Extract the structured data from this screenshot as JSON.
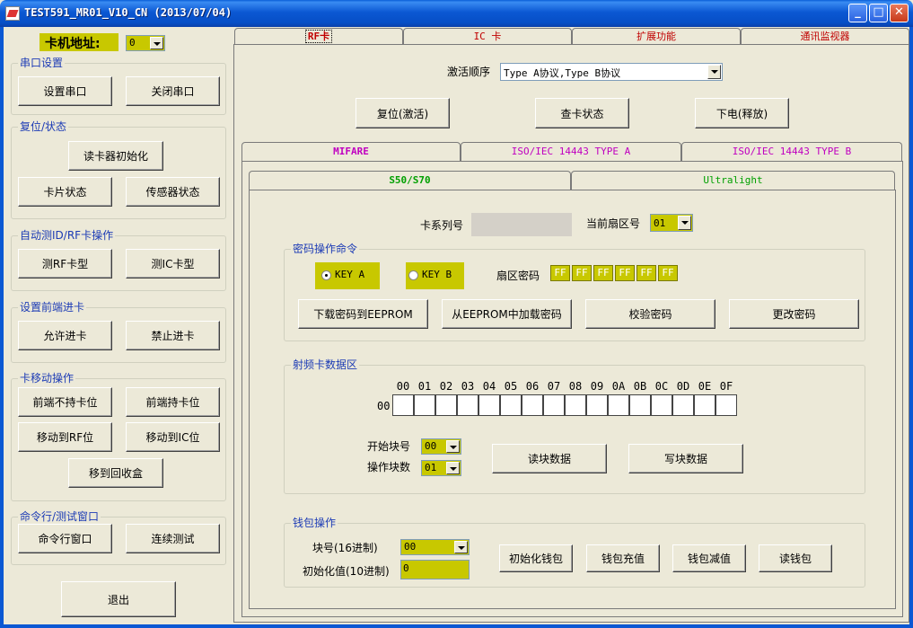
{
  "window": {
    "title": "TEST591_MR01_V10_CN (2013/07/04)",
    "min": "_",
    "max": "□",
    "close": "✕"
  },
  "left": {
    "addr_label": "卡机地址:",
    "addr_value": "0",
    "serial": {
      "title": "串口设置",
      "set": "设置串口",
      "close": "关闭串口"
    },
    "reset": {
      "title": "复位/状态",
      "init": "读卡器初始化",
      "card_status": "卡片状态",
      "sensor_status": "传感器状态"
    },
    "auto": {
      "title": "自动测ID/RF卡操作",
      "rf": "测RF卡型",
      "ic": "测IC卡型"
    },
    "front": {
      "title": "设置前端进卡",
      "allow": "允许进卡",
      "forbid": "禁止进卡"
    },
    "move": {
      "title": "卡移动操作",
      "front_nohold": "前端不持卡位",
      "front_hold": "前端持卡位",
      "to_rf": "移动到RF位",
      "to_ic": "移动到IC位",
      "to_bin": "移到回收盒"
    },
    "cmd": {
      "title": "命令行/测试窗口",
      "cmd_window": "命令行窗口",
      "continuous": "连续测试"
    },
    "exit": "退出"
  },
  "top_tabs": [
    "RF卡",
    "IC 卡",
    "扩展功能",
    "通讯监视器"
  ],
  "rf": {
    "activate_label": "激活顺序",
    "activate_value": "Type A协议,Type B协议",
    "reset_btn": "复位(激活)",
    "check_btn": "查卡状态",
    "power_btn": "下电(释放)"
  },
  "sub_tabs": [
    "MIFARE",
    "ISO/IEC 14443 TYPE A",
    "ISO/IEC 14443 TYPE B"
  ],
  "card_tabs": [
    "S50/S70",
    "Ultralight"
  ],
  "mifare": {
    "serial_label": "卡系列号",
    "sector_label": "当前扇区号",
    "sector_value": "01",
    "pwd": {
      "title": "密码操作命令",
      "key_a": "KEY A",
      "key_b": "KEY B",
      "sector_pwd_label": "扇区密码",
      "pwd_bytes": [
        "FF",
        "FF",
        "FF",
        "FF",
        "FF",
        "FF"
      ],
      "download": "下载密码到EEPROM",
      "load": "从EEPROM中加载密码",
      "verify": "校验密码",
      "change": "更改密码"
    },
    "data": {
      "title": "射频卡数据区",
      "headers": [
        "00",
        "01",
        "02",
        "03",
        "04",
        "05",
        "06",
        "07",
        "08",
        "09",
        "0A",
        "0B",
        "0C",
        "0D",
        "0E",
        "0F"
      ],
      "row_label": "00",
      "start_block_label": "开始块号",
      "start_block_value": "00",
      "block_count_label": "操作块数",
      "block_count_value": "01",
      "read": "读块数据",
      "write": "写块数据"
    },
    "wallet": {
      "title": "钱包操作",
      "block_label": "块号(16进制)",
      "block_value": "00",
      "init_label": "初始化值(10进制)",
      "init_value": "0",
      "init": "初始化钱包",
      "charge": "钱包充值",
      "deduct": "钱包减值",
      "read": "读钱包"
    }
  },
  "colors": {
    "accent_yellow": "#c8c800",
    "tab_magenta": "#c000c0",
    "tab_green": "#00a000",
    "tab_red": "#c00000",
    "group_blue": "#1c3bb5"
  }
}
